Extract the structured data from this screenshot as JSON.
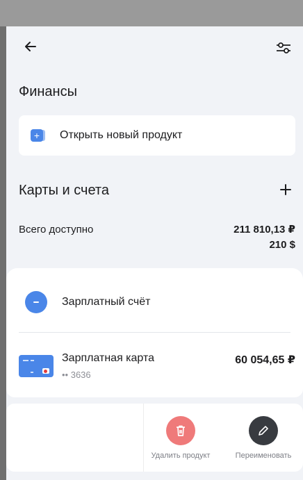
{
  "header": {
    "back_icon": "arrow-left-icon",
    "filter_icon": "sliders-icon"
  },
  "finance": {
    "title": "Финансы",
    "open_product_label": "Открыть новый продукт"
  },
  "cards_section": {
    "title": "Карты и счета",
    "available_label": "Всего доступно",
    "available_rub": "211 810,13 ₽",
    "available_usd": "210 $"
  },
  "accounts": {
    "salary_account": "Зарплатный счёт",
    "card_name": "Зарплатная карта",
    "card_number": "•• 3636",
    "card_amount": "60 054,65 ₽"
  },
  "swipe_actions": {
    "delete_label": "Удалить продукт",
    "rename_label": "Переименовать"
  },
  "colors": {
    "accent": "#4a86e8",
    "delete": "#ef7a7a",
    "rename": "#383b40",
    "background": "#f1f3f7"
  }
}
